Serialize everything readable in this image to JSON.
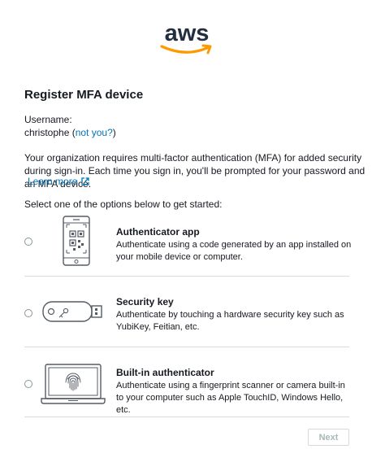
{
  "brand": {
    "logo_text": "aws",
    "accent": "#ff9900",
    "dark": "#232f3e"
  },
  "title": "Register MFA device",
  "username": {
    "label": "Username:",
    "value": "christophe",
    "open_paren": " (",
    "not_you": "not you?",
    "close_paren": ")"
  },
  "description": "Your organization requires multi-factor authentication (MFA) for added security during sign-in. Each time you sign in, you'll be prompted for your password and an MFA device.",
  "learn_more": {
    "label": "Learn more",
    "icon": "external-link-icon"
  },
  "prompt": "Select one of the options below to get started:",
  "options": [
    {
      "title": "Authenticator app",
      "description": "Authenticate using a code generated by an app installed on your mobile device or computer.",
      "icon": "phone-qr-icon",
      "selected": false
    },
    {
      "title": "Security key",
      "description": "Authenticate by touching a hardware security key such as YubiKey, Feitian, etc.",
      "icon": "usb-key-icon",
      "selected": false
    },
    {
      "title": "Built-in authenticator",
      "description": "Authenticate using a fingerprint scanner or camera built-in to your computer such as Apple TouchID, Windows Hello, etc.",
      "icon": "laptop-fingerprint-icon",
      "selected": false
    }
  ],
  "next_button": {
    "label": "Next",
    "disabled": true
  }
}
